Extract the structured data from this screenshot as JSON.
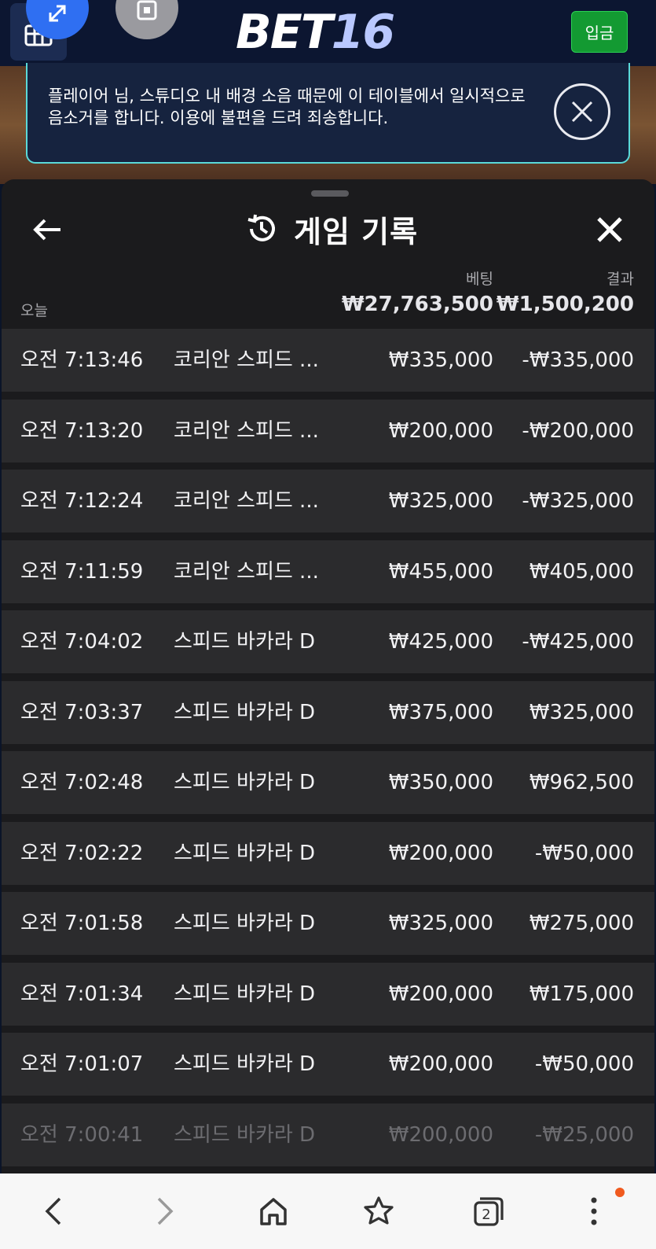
{
  "header": {
    "logo_part1": "BET",
    "logo_part2": "16",
    "deposit_label": "입금"
  },
  "notice": {
    "text": "플레이어 님, 스튜디오 내 배경 소음 때문에 이 테이블에서 일시적으로 음소거를 합니다. 이용에 불편을 드려 죄송합니다."
  },
  "history": {
    "title": "게임 기록",
    "bet_label": "베팅",
    "result_label": "결과",
    "today_label": "오늘",
    "total_bet": "₩27,763,500",
    "total_result": "₩1,500,200",
    "rows": [
      {
        "time": "오전 7:13:46",
        "game": "코리안 스피드 ...",
        "bet": "₩335,000",
        "result": "-₩335,000"
      },
      {
        "time": "오전 7:13:20",
        "game": "코리안 스피드 ...",
        "bet": "₩200,000",
        "result": "-₩200,000"
      },
      {
        "time": "오전 7:12:24",
        "game": "코리안 스피드 ...",
        "bet": "₩325,000",
        "result": "-₩325,000"
      },
      {
        "time": "오전 7:11:59",
        "game": "코리안 스피드 ...",
        "bet": "₩455,000",
        "result": "₩405,000"
      },
      {
        "time": "오전 7:04:02",
        "game": "스피드 바카라 D",
        "bet": "₩425,000",
        "result": "-₩425,000"
      },
      {
        "time": "오전 7:03:37",
        "game": "스피드 바카라 D",
        "bet": "₩375,000",
        "result": "₩325,000"
      },
      {
        "time": "오전 7:02:48",
        "game": "스피드 바카라 D",
        "bet": "₩350,000",
        "result": "₩962,500"
      },
      {
        "time": "오전 7:02:22",
        "game": "스피드 바카라 D",
        "bet": "₩200,000",
        "result": "-₩50,000"
      },
      {
        "time": "오전 7:01:58",
        "game": "스피드 바카라 D",
        "bet": "₩325,000",
        "result": "₩275,000"
      },
      {
        "time": "오전 7:01:34",
        "game": "스피드 바카라 D",
        "bet": "₩200,000",
        "result": "₩175,000"
      },
      {
        "time": "오전 7:01:07",
        "game": "스피드 바카라 D",
        "bet": "₩200,000",
        "result": "-₩50,000"
      },
      {
        "time": "오전 7:00:41",
        "game": "스피드 바카라 D",
        "bet": "₩200,000",
        "result": "-₩25,000"
      }
    ]
  },
  "browser_nav": {
    "tab_count": "2"
  },
  "colors": {
    "deposit_green": "#139a32",
    "notice_border": "#5ad9d9",
    "panel_bg": "#1b1b1d",
    "row_bg": "#2b2b2d",
    "fab_blue": "#2f6ff2",
    "notification_dot": "#f05a1e"
  },
  "icons": [
    "lobby-grid-icon",
    "expand-icon",
    "stop-icon",
    "close-circle-icon",
    "back-arrow-icon",
    "history-icon",
    "close-icon",
    "browser-back-icon",
    "browser-forward-icon",
    "home-icon",
    "bookmark-star-icon",
    "tabs-icon",
    "more-icon"
  ]
}
